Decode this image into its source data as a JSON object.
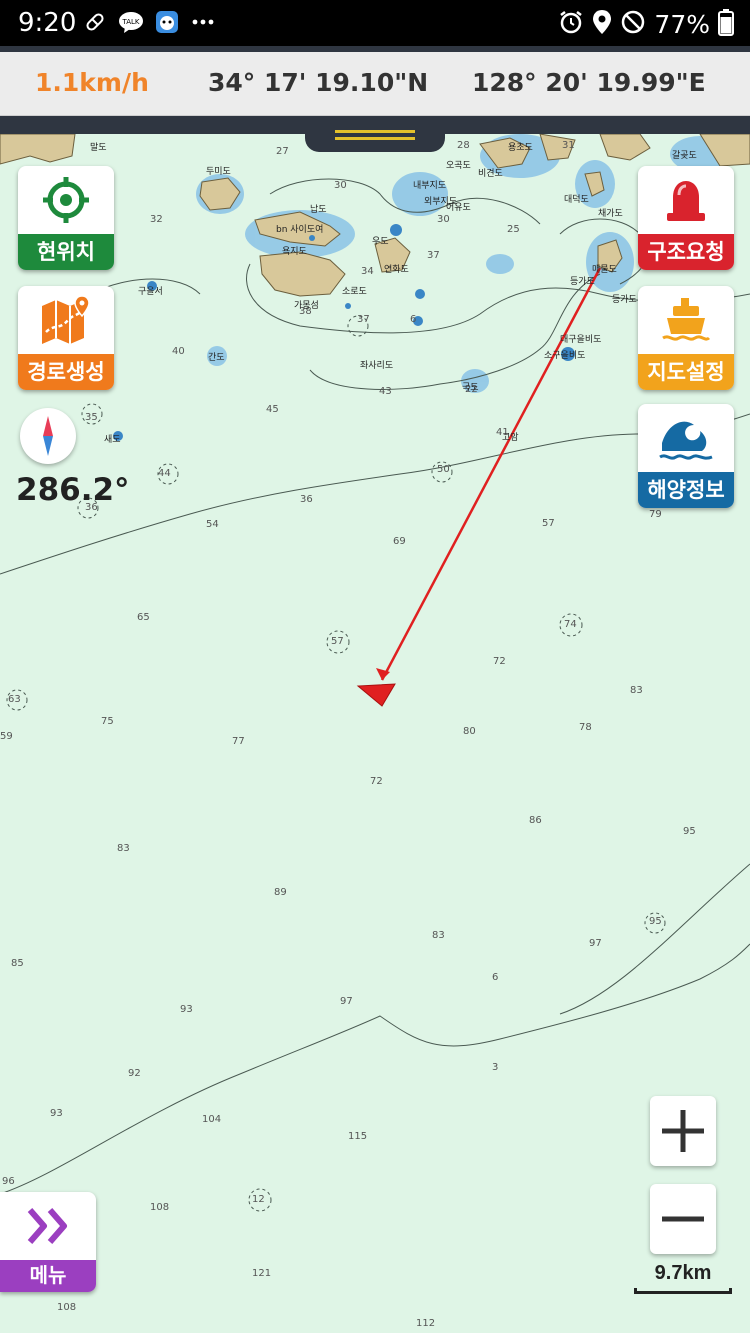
{
  "status_bar": {
    "time": "9:20",
    "battery": "77%",
    "notification_icons": [
      "pill-icon",
      "kakaotalk-icon",
      "app-icon",
      "more-icon"
    ],
    "system_icons": [
      "alarm-icon",
      "location-icon",
      "do-not-disturb-icon",
      "battery-icon"
    ]
  },
  "info_bar": {
    "speed": "1.1km/h",
    "latitude": "34° 17' 19.10\"N",
    "longitude": "128° 20' 19.99\"E",
    "speed_color": "#f0842a"
  },
  "left_buttons": {
    "current_location": "현위치",
    "route_create": "경로생성"
  },
  "right_buttons": {
    "rescue_request": "구조요청",
    "map_settings": "지도설정",
    "ocean_info": "해양정보"
  },
  "heading": "286.2°",
  "zoom": {
    "in": "+",
    "out": "−"
  },
  "scale": "9.7km",
  "menu": {
    "label": "메뉴"
  },
  "colors": {
    "green": "#1e8a3c",
    "orange": "#f07a1c",
    "red": "#d9232d",
    "amber": "#f2a31c",
    "blue": "#156aa3",
    "purple": "#9b3fc0",
    "sea": "#dff5e6",
    "land": "#d8c89a",
    "shallow": "#8fc6e6"
  },
  "map": {
    "depth_soundings": [
      "27",
      "30",
      "28",
      "31",
      "32",
      "30",
      "25",
      "37",
      "34",
      "38",
      "37",
      "40",
      "45",
      "35",
      "44",
      "36",
      "36",
      "54",
      "50",
      "57",
      "69",
      "65",
      "57",
      "74",
      "72",
      "63",
      "75",
      "77",
      "80",
      "78",
      "83",
      "59",
      "72",
      "86",
      "83",
      "95",
      "89",
      "83",
      "97",
      "95",
      "85",
      "6",
      "97",
      "93",
      "92",
      "3",
      "93",
      "104",
      "115",
      "96",
      "108",
      "12",
      "121",
      "108",
      "112",
      "79",
      "43",
      "41",
      "6",
      "22"
    ],
    "place_labels": [
      "말도",
      "두미도",
      "납도",
      "bn 사이도여",
      "욕지도",
      "구을서",
      "가몽섬",
      "소로도",
      "연화도",
      "우도",
      "오곡도",
      "비견도",
      "용초도",
      "대덕도",
      "갈곶도",
      "매물도",
      "등가도",
      "대구을비도",
      "소구을비도",
      "좌사리도",
      "국도",
      "새도",
      "간도",
      "고암",
      "내부지도",
      "외부지도",
      "어유도",
      "채가도",
      "등가도"
    ]
  }
}
